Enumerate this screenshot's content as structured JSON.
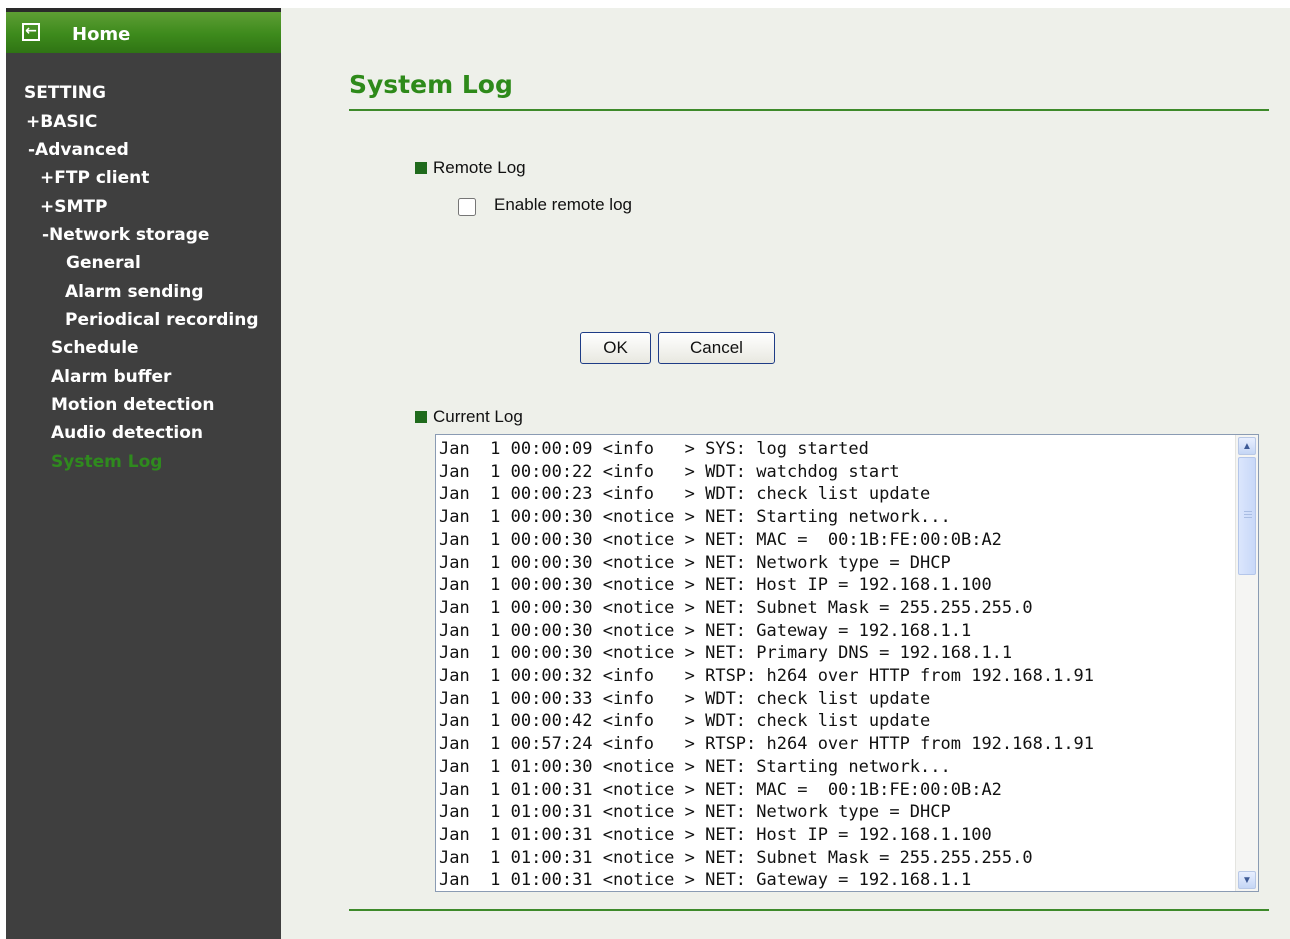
{
  "sidebar": {
    "home_label": "Home",
    "items": [
      {
        "label": "SETTING",
        "active": false
      },
      {
        "label": "+BASIC",
        "active": false
      },
      {
        "label": "-Advanced",
        "active": false
      },
      {
        "label": "+FTP client",
        "active": false
      },
      {
        "label": "+SMTP",
        "active": false
      },
      {
        "label": "-Network storage",
        "active": false
      },
      {
        "label": "General",
        "active": false
      },
      {
        "label": "Alarm sending",
        "active": false
      },
      {
        "label": "Periodical recording",
        "active": false
      },
      {
        "label": "Schedule",
        "active": false
      },
      {
        "label": "Alarm buffer",
        "active": false
      },
      {
        "label": "Motion detection",
        "active": false
      },
      {
        "label": "Audio detection",
        "active": false
      },
      {
        "label": "System Log",
        "active": true
      }
    ]
  },
  "main": {
    "title": "System Log",
    "remote_log": {
      "section_label": "Remote Log",
      "enable_label": "Enable remote log",
      "enabled": false
    },
    "buttons": {
      "ok_label": "OK",
      "cancel_label": "Cancel"
    },
    "current_log": {
      "section_label": "Current Log",
      "lines": [
        "Jan  1 00:00:09 <info   > SYS: log started",
        "Jan  1 00:00:22 <info   > WDT: watchdog start",
        "Jan  1 00:00:23 <info   > WDT: check list update",
        "Jan  1 00:00:30 <notice > NET: Starting network...",
        "Jan  1 00:00:30 <notice > NET: MAC =  00:1B:FE:00:0B:A2",
        "Jan  1 00:00:30 <notice > NET: Network type = DHCP",
        "Jan  1 00:00:30 <notice > NET: Host IP = 192.168.1.100",
        "Jan  1 00:00:30 <notice > NET: Subnet Mask = 255.255.255.0",
        "Jan  1 00:00:30 <notice > NET: Gateway = 192.168.1.1",
        "Jan  1 00:00:30 <notice > NET: Primary DNS = 192.168.1.1",
        "Jan  1 00:00:32 <info   > RTSP: h264 over HTTP from 192.168.1.91",
        "Jan  1 00:00:33 <info   > WDT: check list update",
        "Jan  1 00:00:42 <info   > WDT: check list update",
        "Jan  1 00:57:24 <info   > RTSP: h264 over HTTP from 192.168.1.91",
        "Jan  1 01:00:30 <notice > NET: Starting network...",
        "Jan  1 01:00:31 <notice > NET: MAC =  00:1B:FE:00:0B:A2",
        "Jan  1 01:00:31 <notice > NET: Network type = DHCP",
        "Jan  1 01:00:31 <notice > NET: Host IP = 192.168.1.100",
        "Jan  1 01:00:31 <notice > NET: Subnet Mask = 255.255.255.0",
        "Jan  1 01:00:31 <notice > NET: Gateway = 192.168.1.1"
      ]
    }
  },
  "icons": {
    "home": "back-arrow-icon",
    "section_marker": "green-square-icon",
    "scroll_up": "scroll-up-arrow-icon",
    "scroll_down": "scroll-down-arrow-icon"
  },
  "colors": {
    "accent_green": "#2e8a1a",
    "sidebar_bg": "#3f3f3f",
    "page_bg": "#eef0ea"
  }
}
